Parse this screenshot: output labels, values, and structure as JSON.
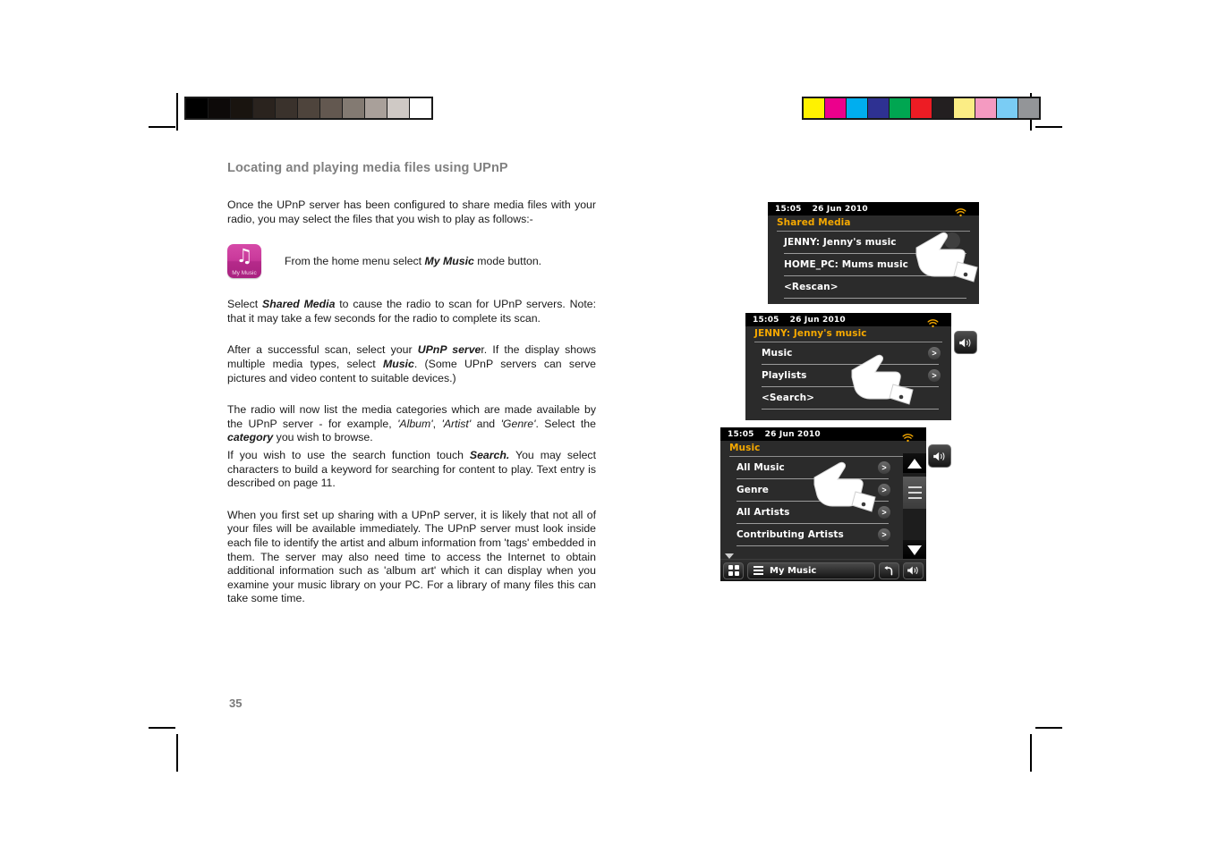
{
  "document": {
    "page_number": "35",
    "section_title": "Locating and playing media files using UPnP",
    "paragraphs": {
      "intro": "Once the UPnP server has been configured to share media files with your radio, you may select the files that you wish to play as follows:-",
      "icon_caption_pre": "From the home menu select ",
      "icon_caption_bold": "My Music",
      "icon_caption_post": " mode button.",
      "p2_pre": "Select ",
      "p2_bold": "Shared Media",
      "p2_post": " to cause the radio to scan for UPnP servers. Note: that it may take a few seconds for the radio to complete its scan.",
      "p3_pre": "After a successful scan, select your ",
      "p3_bold1": "UPnP serve",
      "p3_mid": "r. If the display shows multiple media types, select ",
      "p3_bold2": "Music",
      "p3_post": ". (Some UPnP servers can serve pictures and video content to suitable devices.)",
      "p4_pre": "The radio will now list the media categories which are made available by the UPnP server - for example, ",
      "p4_it1": "'Album'",
      "p4_sep1": ", ",
      "p4_it2": "'Artist'",
      "p4_sep2": " and ",
      "p4_it3": "'Genre'",
      "p4_mid": ". Select the ",
      "p4_bold": "category",
      "p4_post": " you wish to browse.",
      "p5_pre": "If you wish to use the search function touch ",
      "p5_bold": "Search.",
      "p5_post": " You may select characters to build a keyword for searching for content to play. Text entry is described on page 11.",
      "p6": "When you first set up sharing with a UPnP server, it is likely that not all of your files will be available immediately. The UPnP server must look inside each file to identify the artist and album information from 'tags' embedded in them. The server  may also need time to access the Internet to obtain additional information such as 'album art' which it can display when you examine your music library on your PC. For a library of many files this can take some time."
    },
    "my_music_icon": {
      "label": "My Music",
      "glyph": "♫",
      "color": "#c8389a",
      "icon_name": "my-music-mode-icon"
    }
  },
  "calibration": {
    "grey_bar": [
      "#000000",
      "#0d0a09",
      "#19140f",
      "#2a231e",
      "#3a322c",
      "#4e443c",
      "#635850",
      "#837a72",
      "#a9a09a",
      "#cfc9c5",
      "#ffffff"
    ],
    "color_bar": [
      "#fff200",
      "#ec008c",
      "#00aeef",
      "#2e3192",
      "#00a651",
      "#ed1c24",
      "#231f20",
      "#fbed85",
      "#f49ac1",
      "#7accf4",
      "#939598"
    ]
  },
  "screens": [
    {
      "id": "shared-media",
      "statusbar": {
        "time": "15:05",
        "date": "26 Jun 2010",
        "wifi_icon": "wifi-icon"
      },
      "title": "Shared Media",
      "items": [
        {
          "label": "JENNY: Jenny's music",
          "chevron": ""
        },
        {
          "label": "HOME_PC: Mums music",
          "chevron": ""
        },
        {
          "label": "<Rescan>",
          "chevron": ""
        }
      ]
    },
    {
      "id": "jenny-music",
      "statusbar": {
        "time": "15:05",
        "date": "26 Jun 2010",
        "wifi_icon": "wifi-icon"
      },
      "title": "JENNY: Jenny's music",
      "items": [
        {
          "label": "Music",
          "chevron": ">"
        },
        {
          "label": "Playlists",
          "chevron": ">"
        },
        {
          "label": "<Search>",
          "chevron": ""
        }
      ],
      "volume_button": "volume-icon"
    },
    {
      "id": "music",
      "statusbar": {
        "time": "15:05",
        "date": "26 Jun 2010",
        "wifi_icon": "wifi-icon"
      },
      "title": "Music",
      "items": [
        {
          "label": "All Music",
          "chevron": ">"
        },
        {
          "label": "Genre",
          "chevron": ">"
        },
        {
          "label": "All Artists",
          "chevron": ">"
        },
        {
          "label": "Contributing Artists",
          "chevron": ">"
        }
      ],
      "scroll": {
        "up": "scroll-up-icon",
        "handle": "scroll-handle-icon",
        "down": "scroll-down-icon"
      },
      "bottombar": {
        "home_icon": "home-grid-icon",
        "menu_icon": "menu-hamburger-icon",
        "menu_label": "My Music",
        "back_icon": "back-arrow-icon",
        "volume_icon": "volume-icon"
      },
      "volume_button": "volume-icon"
    }
  ]
}
